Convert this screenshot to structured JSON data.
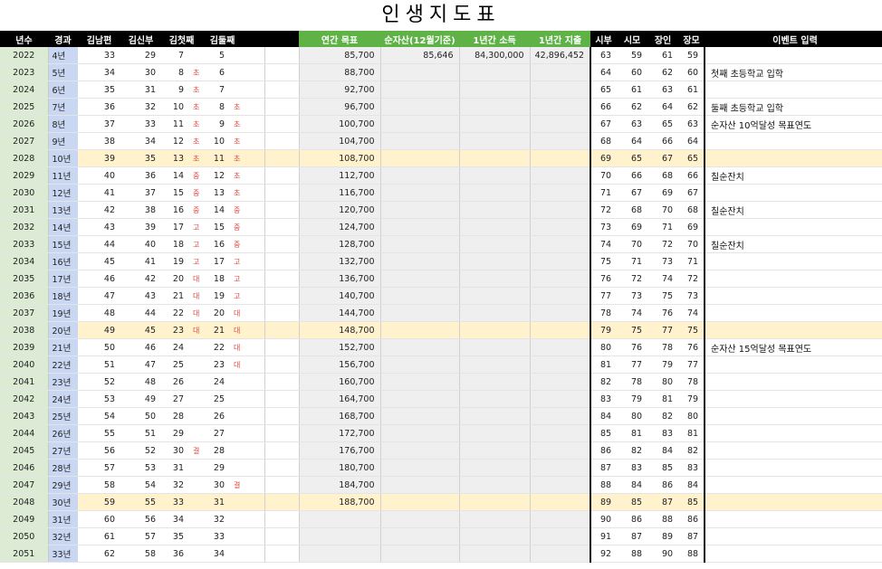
{
  "title": "인생지도표",
  "headers": [
    "년수",
    "경과",
    "김남편",
    "김신부",
    "김첫째",
    "",
    "김둘째",
    "",
    "",
    "",
    "연간 목표",
    "순자산(12월기준)",
    "1년간 소득",
    "1년간 지출",
    "시부",
    "시모",
    "장인",
    "장모",
    "이벤트 입력"
  ],
  "rows": [
    {
      "year": "2022",
      "el": "4년",
      "hus": "33",
      "wife": "29",
      "c1": "7",
      "c1s": "",
      "c2": "5",
      "c2s": "",
      "goal": "85,700",
      "net": "85,646",
      "inc": "84,300,000",
      "exp": "42,896,452",
      "f1": "63",
      "f2": "59",
      "f3": "61",
      "f4": "59",
      "event": ""
    },
    {
      "year": "2023",
      "el": "5년",
      "hus": "34",
      "wife": "30",
      "c1": "8",
      "c1s": "초",
      "c2": "6",
      "c2s": "",
      "goal": "88,700",
      "net": "",
      "inc": "",
      "exp": "",
      "f1": "64",
      "f2": "60",
      "f3": "62",
      "f4": "60",
      "event": "첫째 초등학교 입학"
    },
    {
      "year": "2024",
      "el": "6년",
      "hus": "35",
      "wife": "31",
      "c1": "9",
      "c1s": "초",
      "c2": "7",
      "c2s": "",
      "goal": "92,700",
      "net": "",
      "inc": "",
      "exp": "",
      "f1": "65",
      "f2": "61",
      "f3": "63",
      "f4": "61",
      "event": ""
    },
    {
      "year": "2025",
      "el": "7년",
      "hus": "36",
      "wife": "32",
      "c1": "10",
      "c1s": "초",
      "c2": "8",
      "c2s": "초",
      "goal": "96,700",
      "net": "",
      "inc": "",
      "exp": "",
      "f1": "66",
      "f2": "62",
      "f3": "64",
      "f4": "62",
      "event": "둘째 초등학교 입학"
    },
    {
      "year": "2026",
      "el": "8년",
      "hus": "37",
      "wife": "33",
      "c1": "11",
      "c1s": "초",
      "c2": "9",
      "c2s": "초",
      "goal": "100,700",
      "net": "",
      "inc": "",
      "exp": "",
      "f1": "67",
      "f2": "63",
      "f3": "65",
      "f4": "63",
      "event": "순자산 10억달성 목표연도"
    },
    {
      "year": "2027",
      "el": "9년",
      "hus": "38",
      "wife": "34",
      "c1": "12",
      "c1s": "초",
      "c2": "10",
      "c2s": "초",
      "goal": "104,700",
      "net": "",
      "inc": "",
      "exp": "",
      "f1": "68",
      "f2": "64",
      "f3": "66",
      "f4": "64",
      "event": ""
    },
    {
      "year": "2028",
      "el": "10년",
      "hus": "39",
      "wife": "35",
      "c1": "13",
      "c1s": "초",
      "c2": "11",
      "c2s": "초",
      "goal": "108,700",
      "net": "",
      "inc": "",
      "exp": "",
      "f1": "69",
      "f2": "65",
      "f3": "67",
      "f4": "65",
      "event": "",
      "hl": true
    },
    {
      "year": "2029",
      "el": "11년",
      "hus": "40",
      "wife": "36",
      "c1": "14",
      "c1s": "중",
      "c2": "12",
      "c2s": "초",
      "goal": "112,700",
      "net": "",
      "inc": "",
      "exp": "",
      "f1": "70",
      "f2": "66",
      "f3": "68",
      "f4": "66",
      "event": "칠순잔치"
    },
    {
      "year": "2030",
      "el": "12년",
      "hus": "41",
      "wife": "37",
      "c1": "15",
      "c1s": "중",
      "c2": "13",
      "c2s": "초",
      "goal": "116,700",
      "net": "",
      "inc": "",
      "exp": "",
      "f1": "71",
      "f2": "67",
      "f3": "69",
      "f4": "67",
      "event": ""
    },
    {
      "year": "2031",
      "el": "13년",
      "hus": "42",
      "wife": "38",
      "c1": "16",
      "c1s": "중",
      "c2": "14",
      "c2s": "중",
      "goal": "120,700",
      "net": "",
      "inc": "",
      "exp": "",
      "f1": "72",
      "f2": "68",
      "f3": "70",
      "f4": "68",
      "event": "칠순잔치"
    },
    {
      "year": "2032",
      "el": "14년",
      "hus": "43",
      "wife": "39",
      "c1": "17",
      "c1s": "고",
      "c2": "15",
      "c2s": "중",
      "goal": "124,700",
      "net": "",
      "inc": "",
      "exp": "",
      "f1": "73",
      "f2": "69",
      "f3": "71",
      "f4": "69",
      "event": ""
    },
    {
      "year": "2033",
      "el": "15년",
      "hus": "44",
      "wife": "40",
      "c1": "18",
      "c1s": "고",
      "c2": "16",
      "c2s": "중",
      "goal": "128,700",
      "net": "",
      "inc": "",
      "exp": "",
      "f1": "74",
      "f2": "70",
      "f3": "72",
      "f4": "70",
      "event": "칠순잔치"
    },
    {
      "year": "2034",
      "el": "16년",
      "hus": "45",
      "wife": "41",
      "c1": "19",
      "c1s": "고",
      "c2": "17",
      "c2s": "고",
      "goal": "132,700",
      "net": "",
      "inc": "",
      "exp": "",
      "f1": "75",
      "f2": "71",
      "f3": "73",
      "f4": "71",
      "event": ""
    },
    {
      "year": "2035",
      "el": "17년",
      "hus": "46",
      "wife": "42",
      "c1": "20",
      "c1s": "대",
      "c2": "18",
      "c2s": "고",
      "goal": "136,700",
      "net": "",
      "inc": "",
      "exp": "",
      "f1": "76",
      "f2": "72",
      "f3": "74",
      "f4": "72",
      "event": ""
    },
    {
      "year": "2036",
      "el": "18년",
      "hus": "47",
      "wife": "43",
      "c1": "21",
      "c1s": "대",
      "c2": "19",
      "c2s": "고",
      "goal": "140,700",
      "net": "",
      "inc": "",
      "exp": "",
      "f1": "77",
      "f2": "73",
      "f3": "75",
      "f4": "73",
      "event": ""
    },
    {
      "year": "2037",
      "el": "19년",
      "hus": "48",
      "wife": "44",
      "c1": "22",
      "c1s": "대",
      "c2": "20",
      "c2s": "대",
      "goal": "144,700",
      "net": "",
      "inc": "",
      "exp": "",
      "f1": "78",
      "f2": "74",
      "f3": "76",
      "f4": "74",
      "event": ""
    },
    {
      "year": "2038",
      "el": "20년",
      "hus": "49",
      "wife": "45",
      "c1": "23",
      "c1s": "대",
      "c2": "21",
      "c2s": "대",
      "goal": "148,700",
      "net": "",
      "inc": "",
      "exp": "",
      "f1": "79",
      "f2": "75",
      "f3": "77",
      "f4": "75",
      "event": "",
      "hl": true
    },
    {
      "year": "2039",
      "el": "21년",
      "hus": "50",
      "wife": "46",
      "c1": "24",
      "c1s": "",
      "c2": "22",
      "c2s": "대",
      "goal": "152,700",
      "net": "",
      "inc": "",
      "exp": "",
      "f1": "80",
      "f2": "76",
      "f3": "78",
      "f4": "76",
      "event": "순자산 15억달성 목표연도"
    },
    {
      "year": "2040",
      "el": "22년",
      "hus": "51",
      "wife": "47",
      "c1": "25",
      "c1s": "",
      "c2": "23",
      "c2s": "대",
      "goal": "156,700",
      "net": "",
      "inc": "",
      "exp": "",
      "f1": "81",
      "f2": "77",
      "f3": "79",
      "f4": "77",
      "event": ""
    },
    {
      "year": "2041",
      "el": "23년",
      "hus": "52",
      "wife": "48",
      "c1": "26",
      "c1s": "",
      "c2": "24",
      "c2s": "",
      "goal": "160,700",
      "net": "",
      "inc": "",
      "exp": "",
      "f1": "82",
      "f2": "78",
      "f3": "80",
      "f4": "78",
      "event": ""
    },
    {
      "year": "2042",
      "el": "24년",
      "hus": "53",
      "wife": "49",
      "c1": "27",
      "c1s": "",
      "c2": "25",
      "c2s": "",
      "goal": "164,700",
      "net": "",
      "inc": "",
      "exp": "",
      "f1": "83",
      "f2": "79",
      "f3": "81",
      "f4": "79",
      "event": ""
    },
    {
      "year": "2043",
      "el": "25년",
      "hus": "54",
      "wife": "50",
      "c1": "28",
      "c1s": "",
      "c2": "26",
      "c2s": "",
      "goal": "168,700",
      "net": "",
      "inc": "",
      "exp": "",
      "f1": "84",
      "f2": "80",
      "f3": "82",
      "f4": "80",
      "event": ""
    },
    {
      "year": "2044",
      "el": "26년",
      "hus": "55",
      "wife": "51",
      "c1": "29",
      "c1s": "",
      "c2": "27",
      "c2s": "",
      "goal": "172,700",
      "net": "",
      "inc": "",
      "exp": "",
      "f1": "85",
      "f2": "81",
      "f3": "83",
      "f4": "81",
      "event": ""
    },
    {
      "year": "2045",
      "el": "27년",
      "hus": "56",
      "wife": "52",
      "c1": "30",
      "c1s": "결",
      "c2": "28",
      "c2s": "",
      "goal": "176,700",
      "net": "",
      "inc": "",
      "exp": "",
      "f1": "86",
      "f2": "82",
      "f3": "84",
      "f4": "82",
      "event": ""
    },
    {
      "year": "2046",
      "el": "28년",
      "hus": "57",
      "wife": "53",
      "c1": "31",
      "c1s": "",
      "c2": "29",
      "c2s": "",
      "goal": "180,700",
      "net": "",
      "inc": "",
      "exp": "",
      "f1": "87",
      "f2": "83",
      "f3": "85",
      "f4": "83",
      "event": ""
    },
    {
      "year": "2047",
      "el": "29년",
      "hus": "58",
      "wife": "54",
      "c1": "32",
      "c1s": "",
      "c2": "30",
      "c2s": "결",
      "goal": "184,700",
      "net": "",
      "inc": "",
      "exp": "",
      "f1": "88",
      "f2": "84",
      "f3": "86",
      "f4": "84",
      "event": ""
    },
    {
      "year": "2048",
      "el": "30년",
      "hus": "59",
      "wife": "55",
      "c1": "33",
      "c1s": "",
      "c2": "31",
      "c2s": "",
      "goal": "188,700",
      "net": "",
      "inc": "",
      "exp": "",
      "f1": "89",
      "f2": "85",
      "f3": "87",
      "f4": "85",
      "event": "",
      "hl": true
    },
    {
      "year": "2049",
      "el": "31년",
      "hus": "60",
      "wife": "56",
      "c1": "34",
      "c1s": "",
      "c2": "32",
      "c2s": "",
      "goal": "",
      "net": "",
      "inc": "",
      "exp": "",
      "f1": "90",
      "f2": "86",
      "f3": "88",
      "f4": "86",
      "event": ""
    },
    {
      "year": "2050",
      "el": "32년",
      "hus": "61",
      "wife": "57",
      "c1": "35",
      "c1s": "",
      "c2": "33",
      "c2s": "",
      "goal": "",
      "net": "",
      "inc": "",
      "exp": "",
      "f1": "91",
      "f2": "87",
      "f3": "89",
      "f4": "87",
      "event": ""
    },
    {
      "year": "2051",
      "el": "33년",
      "hus": "62",
      "wife": "58",
      "c1": "36",
      "c1s": "",
      "c2": "34",
      "c2s": "",
      "goal": "",
      "net": "",
      "inc": "",
      "exp": "",
      "f1": "92",
      "f2": "88",
      "f3": "90",
      "f4": "88",
      "event": ""
    }
  ]
}
